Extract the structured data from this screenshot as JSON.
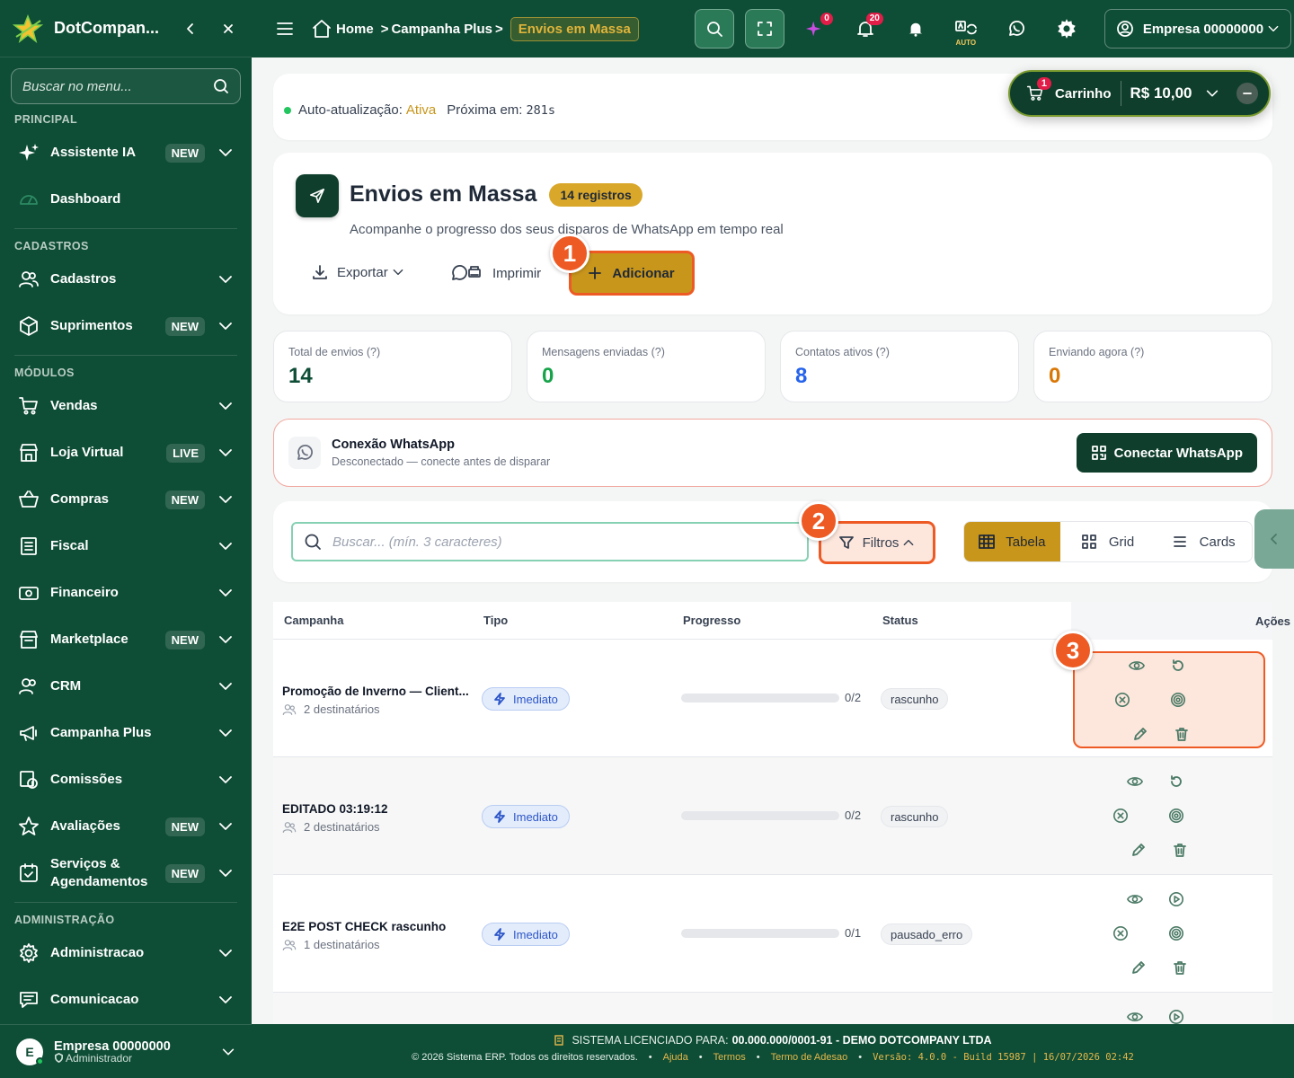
{
  "sidebar": {
    "app_name": "DotCompan...",
    "search_placeholder": "Buscar no menu...",
    "sections": {
      "principal": "PRINCIPAL",
      "cadastros": "CADASTROS",
      "modulos": "MÓDULOS",
      "administracao": "ADMINISTRAÇÃO"
    },
    "items": [
      {
        "label": "Assistente IA",
        "badge": "NEW",
        "icon": "sparkle-icon"
      },
      {
        "label": "Dashboard",
        "icon": "gauge-icon"
      },
      {
        "label": "Cadastros",
        "icon": "users-icon"
      },
      {
        "label": "Suprimentos",
        "badge": "NEW",
        "icon": "box-icon"
      },
      {
        "label": "Vendas",
        "icon": "cart-icon"
      },
      {
        "label": "Loja Virtual",
        "badge": "LIVE",
        "icon": "store-icon"
      },
      {
        "label": "Compras",
        "badge": "NEW",
        "icon": "basket-icon"
      },
      {
        "label": "Fiscal",
        "icon": "document-icon"
      },
      {
        "label": "Financeiro",
        "icon": "money-icon"
      },
      {
        "label": "Marketplace",
        "badge": "NEW",
        "icon": "marketplace-icon"
      },
      {
        "label": "CRM",
        "icon": "crm-icon"
      },
      {
        "label": "Campanha Plus",
        "icon": "megaphone-icon"
      },
      {
        "label": "Comissões",
        "icon": "commission-icon"
      },
      {
        "label": "Avaliações",
        "badge": "NEW",
        "icon": "star-icon"
      },
      {
        "label": "Serviços & Agendamentos",
        "badge": "NEW",
        "icon": "calendar-check-icon"
      },
      {
        "label": "Administracao",
        "icon": "gear-icon"
      },
      {
        "label": "Comunicacao",
        "icon": "message-icon"
      }
    ],
    "user": {
      "initial": "E",
      "name": "Empresa 00000000",
      "role": "Administrador"
    }
  },
  "topbar": {
    "breadcrumb": {
      "home": "Home",
      "parent": "Campanha Plus",
      "current": "Envios em Massa"
    },
    "ai_badge": "0",
    "notifications_badge": "20",
    "auto_label": "AUTO",
    "company": "Empresa 00000000"
  },
  "autoupdate": {
    "label": "Auto-atualização:",
    "state": "Ativa",
    "next_label": "Próxima em:",
    "next_value": "281s"
  },
  "cart": {
    "count": "1",
    "label": "Carrinho",
    "total": "R$ 10,00"
  },
  "page": {
    "title": "Envios em Massa",
    "count_badge": "14 registros",
    "subtitle": "Acompanhe o progresso dos seus disparos de WhatsApp em tempo real",
    "export_label": "Exportar",
    "print_label": "Imprimir",
    "add_label": "Adicionar"
  },
  "stats": [
    {
      "label": "Total de envios (?)",
      "value": "14",
      "color": "#0e4d36"
    },
    {
      "label": "Mensagens enviadas (?)",
      "value": "0",
      "color": "#16a34a"
    },
    {
      "label": "Contatos ativos (?)",
      "value": "8",
      "color": "#2563eb"
    },
    {
      "label": "Enviando agora (?)",
      "value": "0",
      "color": "#d97706"
    }
  ],
  "whatsapp": {
    "title": "Conexão WhatsApp",
    "subtitle": "Desconectado — conecte antes de disparar",
    "button": "Conectar WhatsApp"
  },
  "toolbar": {
    "search_placeholder": "Buscar... (mín. 3 caracteres)",
    "filter_label": "Filtros",
    "views": [
      "Tabela",
      "Grid",
      "Cards"
    ],
    "active_view": "Tabela"
  },
  "annotations": [
    "1",
    "2",
    "3"
  ],
  "table": {
    "headers": [
      "Campanha",
      "Tipo",
      "Progresso",
      "Status",
      "Ações"
    ],
    "rows": [
      {
        "name": "Promoção de Inverno — Client...",
        "recipients": "2 destinatários",
        "type": "Imediato",
        "progress_label": "0/2",
        "progress": 0,
        "status": "rascunho",
        "second_action": "retry-icon"
      },
      {
        "name": "EDITADO 03:19:12",
        "recipients": "2 destinatários",
        "type": "Imediato",
        "progress_label": "0/2",
        "progress": 0,
        "status": "rascunho",
        "second_action": "retry-icon"
      },
      {
        "name": "E2E POST CHECK rascunho",
        "recipients": "1 destinatários",
        "type": "Imediato",
        "progress_label": "0/1",
        "progress": 0,
        "status": "pausado_erro",
        "second_action": "play-icon"
      },
      {
        "name": "",
        "recipients": "",
        "type": "",
        "progress_label": "",
        "progress": 0,
        "status": "",
        "second_action": "play-icon"
      }
    ]
  },
  "footer": {
    "license_label": "SISTEMA LICENCIADO PARA:",
    "license_value": "00.000.000/0001-91 - DEMO DOTCOMPANY LTDA",
    "copyright": "© 2026 Sistema ERP. Todos os direitos reservados.",
    "links": [
      "Ajuda",
      "Termos",
      "Termo de Adesao"
    ],
    "version": "Versão: 4.0.0 - Build 15987 | 16/07/2026 02:42"
  }
}
